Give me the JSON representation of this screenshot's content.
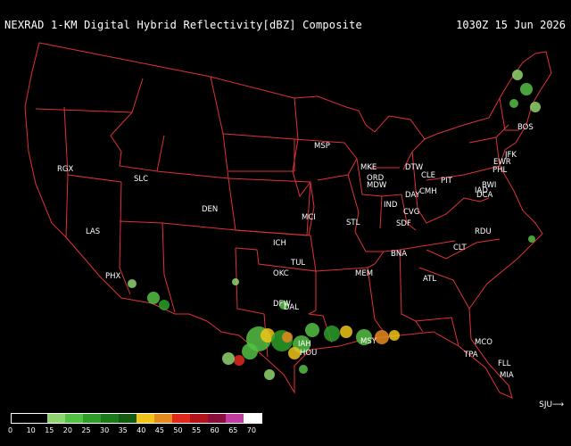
{
  "header": {
    "title": "NEXRAD 1-KM Digital Hybrid Reflectivity[dBZ] Composite",
    "timestamp": "1030Z 15 Jun 2026"
  },
  "credit": "SJU⟶",
  "legend": {
    "labels": [
      "0",
      "10",
      "15",
      "20",
      "25",
      "30",
      "35",
      "40",
      "45",
      "50",
      "55",
      "60",
      "65",
      "70"
    ],
    "colors": [
      "#000000",
      "#000000",
      "#8fd46e",
      "#55c144",
      "#2e9d2a",
      "#1d7a1a",
      "#145c12",
      "#f0c419",
      "#e58a1f",
      "#e0291d",
      "#b2141a",
      "#8a0e3b",
      "#c03ca1",
      "#ffffff"
    ]
  },
  "cities": [
    {
      "code": "RGX"
    },
    {
      "code": "SLC"
    },
    {
      "code": "DEN"
    },
    {
      "code": "LAS"
    },
    {
      "code": "PHX"
    },
    {
      "code": "ICH"
    },
    {
      "code": "MCI"
    },
    {
      "code": "TUL"
    },
    {
      "code": "OKC"
    },
    {
      "code": "DFW"
    },
    {
      "code": "DAL"
    },
    {
      "code": "IAH"
    },
    {
      "code": "HOU"
    },
    {
      "code": "MSP"
    },
    {
      "code": "MKE"
    },
    {
      "code": "ORD"
    },
    {
      "code": "MDW"
    },
    {
      "code": "STL"
    },
    {
      "code": "IND"
    },
    {
      "code": "SDF"
    },
    {
      "code": "DTW"
    },
    {
      "code": "CLE"
    },
    {
      "code": "DAY"
    },
    {
      "code": "CMH"
    },
    {
      "code": "CVG"
    },
    {
      "code": "PIT"
    },
    {
      "code": "MEM"
    },
    {
      "code": "BNA"
    },
    {
      "code": "ATL"
    },
    {
      "code": "CLT"
    },
    {
      "code": "RDU"
    },
    {
      "code": "MSY"
    },
    {
      "code": "TPA"
    },
    {
      "code": "MCO"
    },
    {
      "code": "FLL"
    },
    {
      "code": "MIA"
    },
    {
      "code": "BOS"
    },
    {
      "code": "JFK"
    },
    {
      "code": "EWR"
    },
    {
      "code": "PHL"
    },
    {
      "code": "BWI"
    },
    {
      "code": "IAD"
    },
    {
      "code": "DCA"
    }
  ]
}
